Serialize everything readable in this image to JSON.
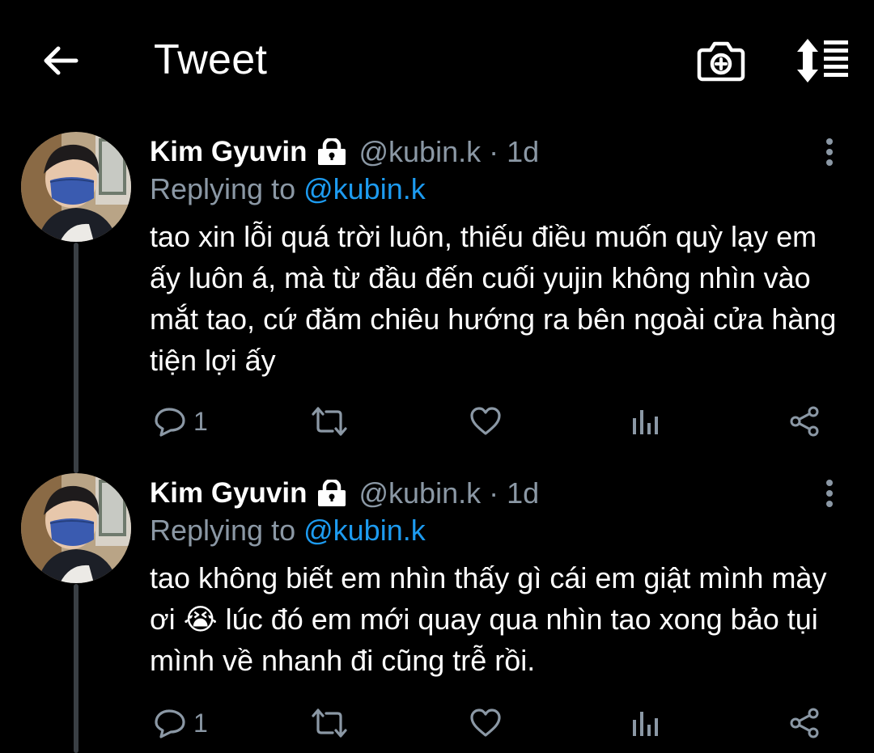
{
  "header": {
    "title": "Tweet",
    "icons": {
      "back": "arrow-left-icon",
      "camera": "camera-plus-icon",
      "sort": "sort-sparkle-icon"
    }
  },
  "tweets": [
    {
      "name": "Kim Gyuvin",
      "protected": true,
      "handle": "@kubin.k",
      "separator": "·",
      "time": "1d",
      "replying_prefix": "Replying to ",
      "replying_to": "@kubin.k",
      "text": "tao xin lỗi quá trời luôn, thiếu điều muốn quỳ lạy em ấy luôn á, mà từ đầu đến cuối yujin không nhìn vào mắt tao, cứ đăm chiêu hướng ra bên ngoài cửa hàng tiện lợi ấy",
      "reply_count": "1"
    },
    {
      "name": "Kim Gyuvin",
      "protected": true,
      "handle": "@kubin.k",
      "separator": "·",
      "time": "1d",
      "replying_prefix": "Replying to ",
      "replying_to": "@kubin.k",
      "text": "tao không biết em nhìn thấy gì cái em giật mình mày ơi 😭 lúc đó em mới quay qua nhìn tao xong bảo tụi mình về nhanh đi cũng trễ rồi.",
      "reply_count": "1"
    }
  ],
  "colors": {
    "background": "#000000",
    "text": "#ffffff",
    "secondary": "#8b98a5",
    "link": "#1d9bf0",
    "thread": "#3a3f44"
  }
}
